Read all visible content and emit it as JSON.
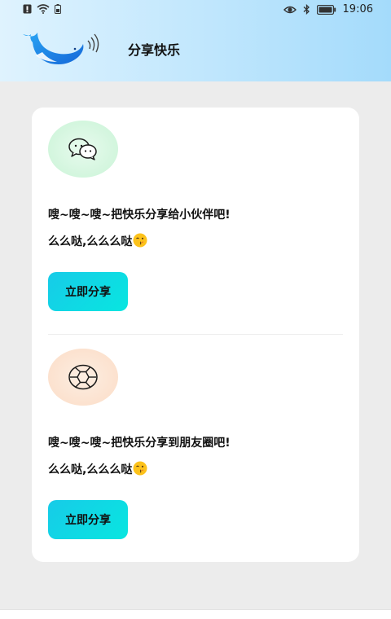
{
  "status_bar": {
    "time": "19:06",
    "left_icons": [
      "alert-icon",
      "wifi-icon",
      "battery-saver-icon"
    ],
    "right_icons": [
      "eye-icon",
      "bluetooth-icon",
      "battery-icon"
    ]
  },
  "header": {
    "title": "分享快乐",
    "logo": "whale-logo"
  },
  "share_items": [
    {
      "icon": "wechat-icon",
      "line1": "嗖~嗖~嗖~把快乐分享给小伙伴吧!",
      "line2": "么么哒,么么么哒",
      "emoji": "kissing-face-emoji",
      "button_label": "立即分享"
    },
    {
      "icon": "moments-icon",
      "line1": "嗖~嗖~嗖~把快乐分享到朋友圈吧!",
      "line2": "么么哒,么么么哒",
      "emoji": "kissing-face-emoji",
      "button_label": "立即分享"
    }
  ],
  "colors": {
    "header_gradient_start": "#dff3fe",
    "header_gradient_end": "#a4dbfb",
    "button_gradient_start": "#17cbe8",
    "button_gradient_end": "#08e6e0",
    "page_background": "#ececec"
  }
}
